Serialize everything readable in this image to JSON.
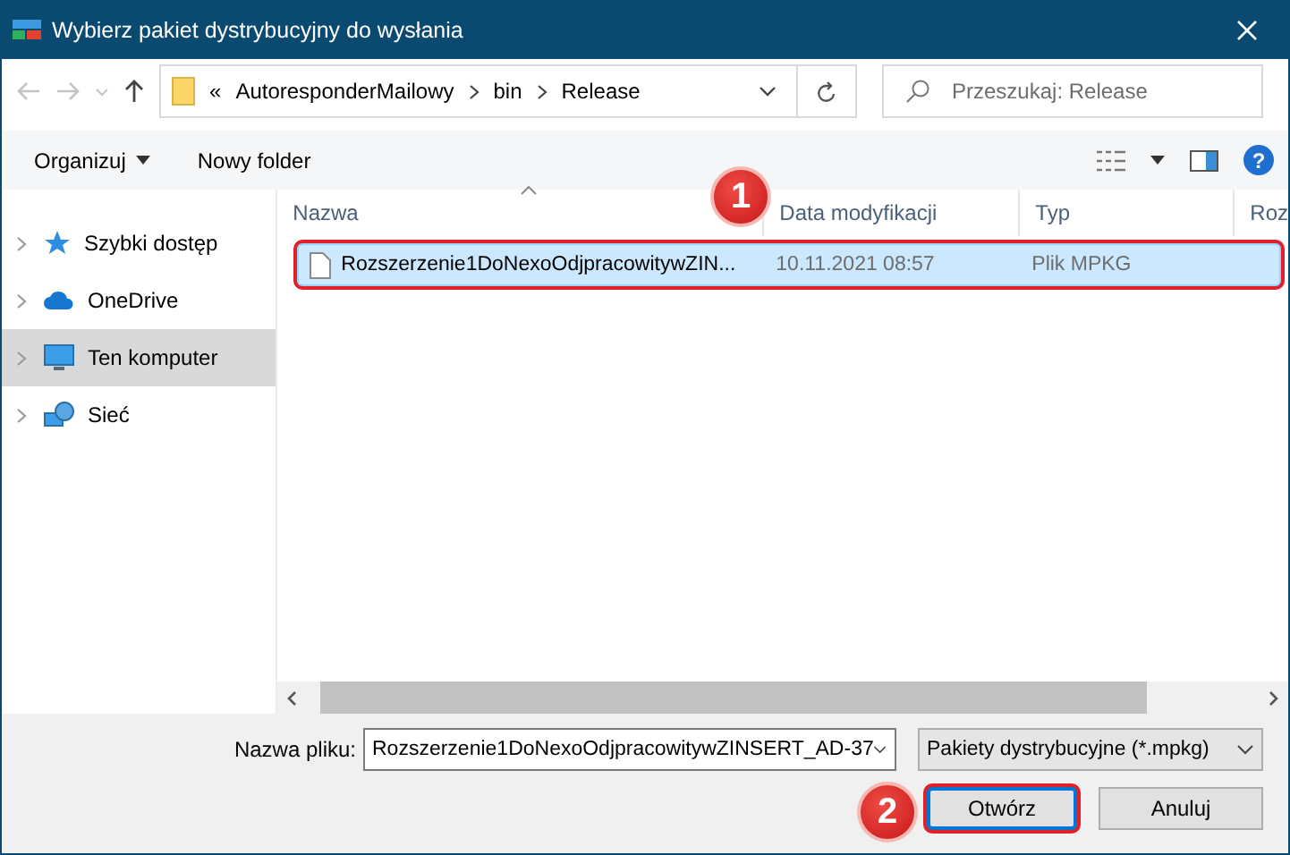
{
  "window": {
    "title": "Wybierz pakiet dystrybucyjny do wysłania"
  },
  "address_bar": {
    "overflow": "«",
    "segments": [
      "AutoresponderMailowy",
      "bin",
      "Release"
    ]
  },
  "search": {
    "placeholder": "Przeszukaj: Release"
  },
  "toolbar": {
    "buttons": [
      "Organizuj",
      "Nowy folder"
    ],
    "help": "?"
  },
  "sidebar": {
    "items": [
      {
        "label": "Szybki dostęp",
        "kind": "star",
        "selected": false
      },
      {
        "label": "OneDrive",
        "kind": "cloud",
        "selected": false
      },
      {
        "label": "Ten komputer",
        "kind": "computer",
        "selected": true
      },
      {
        "label": "Sieć",
        "kind": "network",
        "selected": false
      }
    ]
  },
  "file_list": {
    "columns": [
      "Nazwa",
      "Data modyfikacji",
      "Typ",
      "Roz"
    ],
    "rows": [
      {
        "name": "Rozszerzenie1DoNexoOdjpracowitywZIN...",
        "modified": "10.11.2021 08:57",
        "type": "Plik MPKG",
        "selected": true,
        "annotated": true
      }
    ]
  },
  "file_name": {
    "label": "Nazwa pliku:",
    "value": "Rozszerzenie1DoNexoOdjpracowitywZINSERT_AD-37"
  },
  "file_type": {
    "value": "Pakiety dystrybucyjne (*.mpkg)"
  },
  "buttons": [
    {
      "label": "Otwórz",
      "kind": "primary",
      "annotated": true
    },
    {
      "label": "Anuluj",
      "kind": "secondary",
      "annotated": false
    }
  ],
  "callouts": [
    {
      "label": "1"
    },
    {
      "label": "2"
    }
  ]
}
